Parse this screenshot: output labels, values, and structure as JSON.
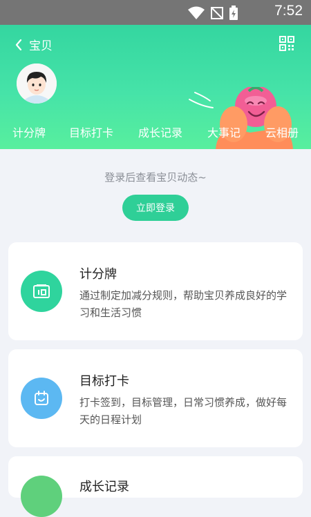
{
  "status_bar": {
    "time": "7:52"
  },
  "header": {
    "back_label": "宝贝",
    "tabs": [
      "计分牌",
      "目标打卡",
      "成长记录",
      "大事记",
      "云相册"
    ]
  },
  "login": {
    "tip": "登录后查看宝贝动态~",
    "button": "立即登录"
  },
  "cards": [
    {
      "title": "计分牌",
      "desc": "通过制定加减分规则，帮助宝贝养成良好的学习和生活习惯",
      "color": "#2fd49d"
    },
    {
      "title": "目标打卡",
      "desc": "打卡签到，目标管理，日常习惯养成，做好每天的日程计划",
      "color": "#5cb8f2"
    },
    {
      "title": "成长记录",
      "color": "#5fd07c"
    }
  ]
}
